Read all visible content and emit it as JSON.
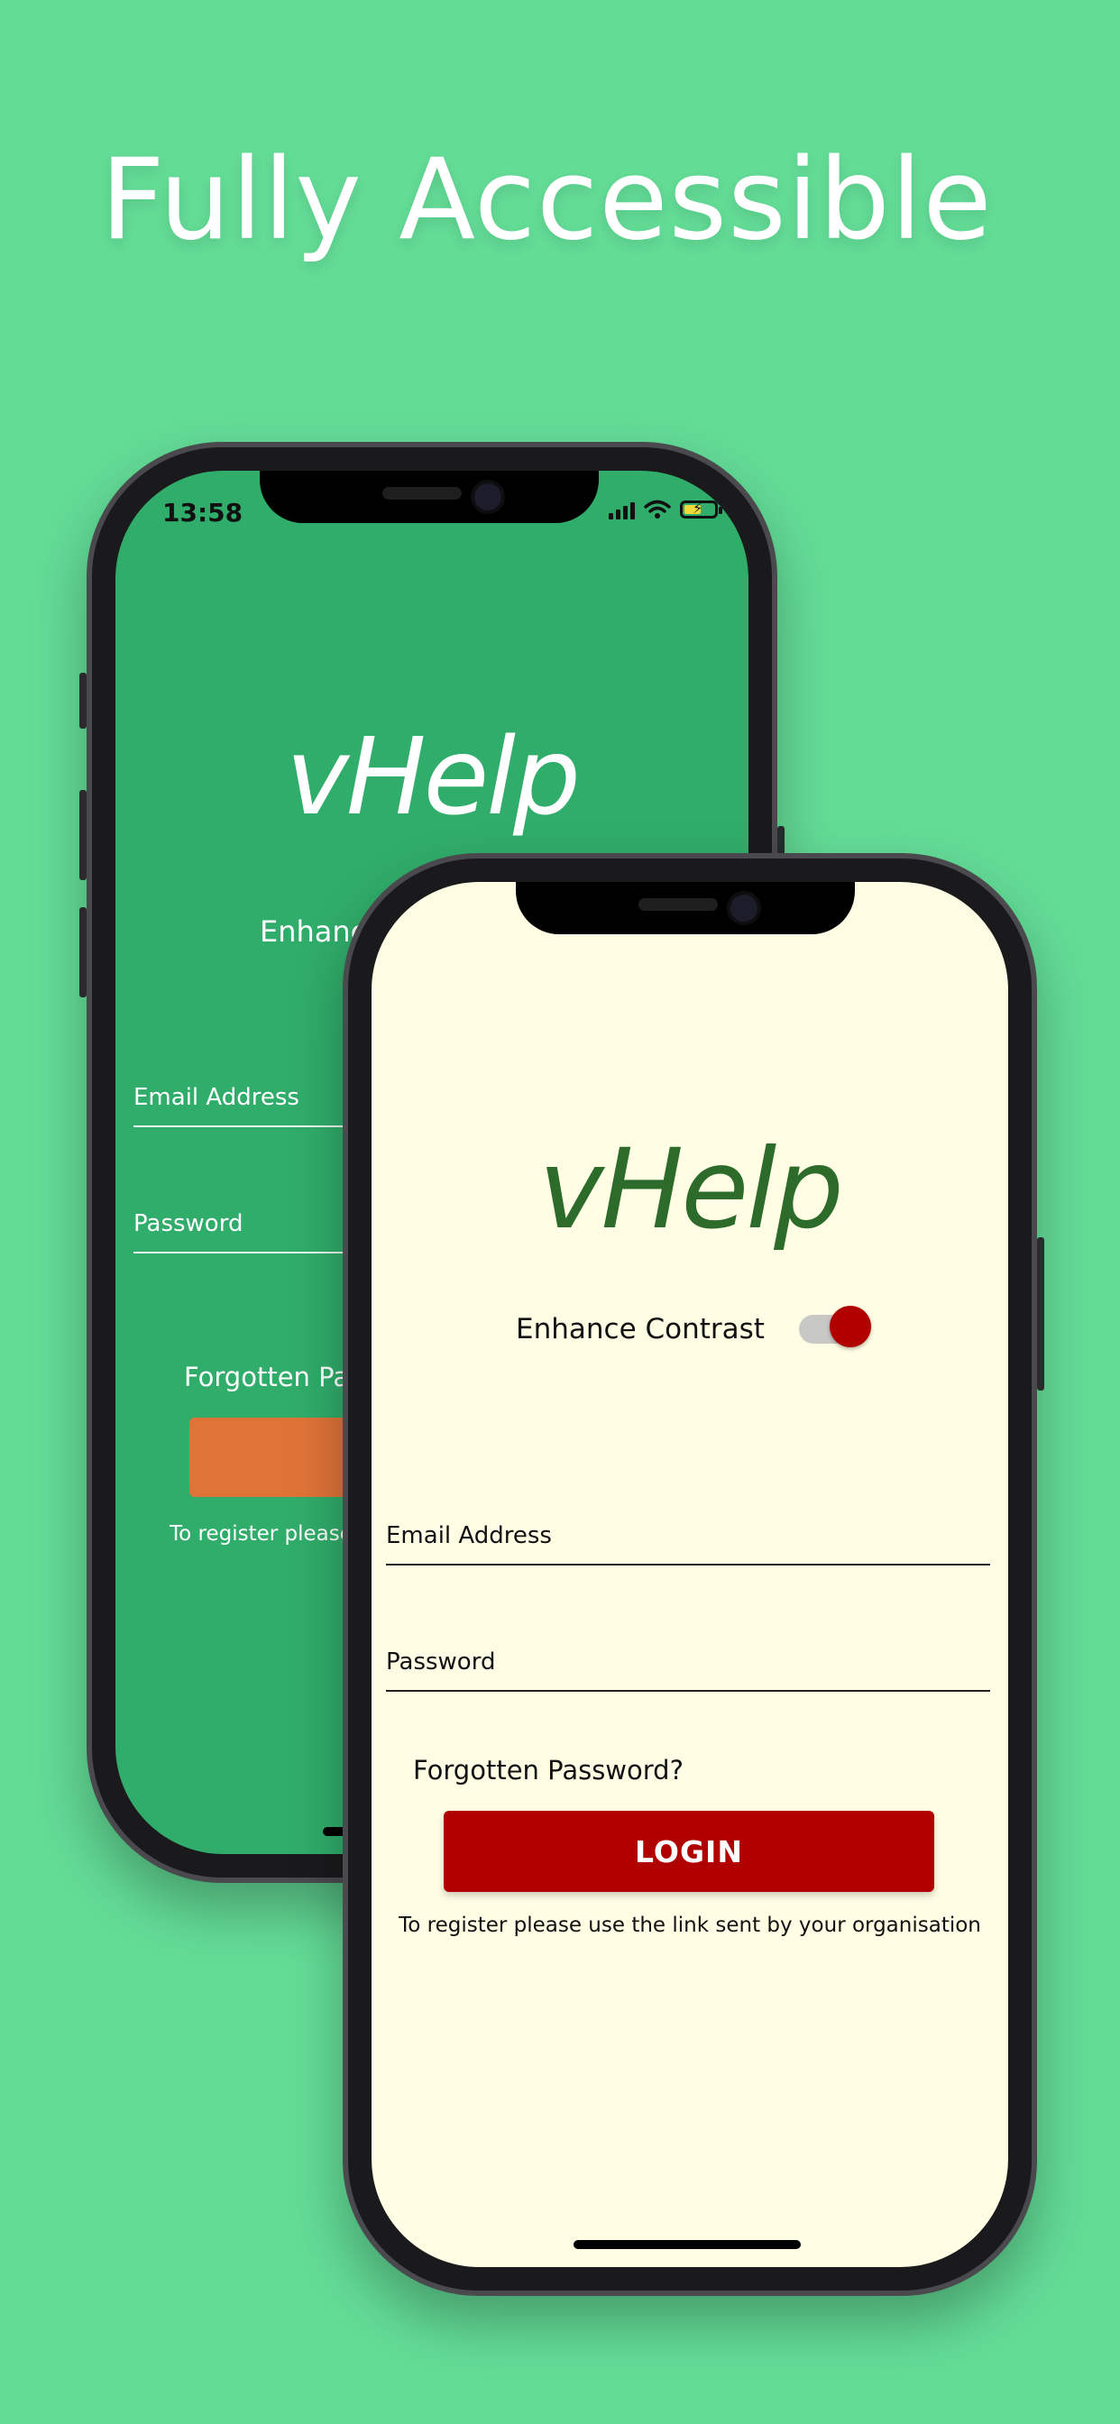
{
  "headline": "Fully Accessible",
  "colors": {
    "background": "#63dc96",
    "back_screen": "#30ad6a",
    "front_screen": "#fffde4",
    "back_login_button": "#e07438",
    "front_login_button": "#b00000",
    "front_logo": "#2c6b2a"
  },
  "back_phone": {
    "status_time": "13:58",
    "status_icons": [
      "cellular-signal-icon",
      "wifi-icon",
      "battery-charging-icon"
    ],
    "logo": "vHelp",
    "contrast_label_partial": "Enhanc",
    "email_label": "Email Address",
    "password_label": "Password",
    "forgot_partial": "Forgotten Passw",
    "register_partial": "To register please u"
  },
  "front_phone": {
    "logo": "vHelp",
    "toggle": {
      "label": "Enhance Contrast",
      "state": "on"
    },
    "email_label": "Email Address",
    "password_label": "Password",
    "forgot_password": "Forgotten Password?",
    "login_button": "LOGIN",
    "register_text": "To register please use the link sent by your organisation"
  }
}
